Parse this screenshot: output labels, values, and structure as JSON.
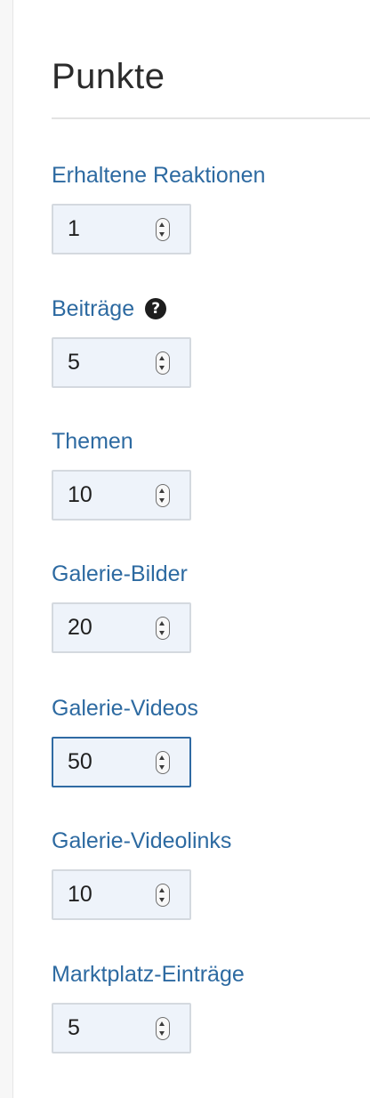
{
  "section": {
    "title": "Punkte"
  },
  "fields": [
    {
      "label": "Erhaltene Reaktionen",
      "value": "1",
      "has_help": false,
      "focused": false
    },
    {
      "label": "Beiträge",
      "value": "5",
      "has_help": true,
      "help_glyph": "?",
      "focused": false
    },
    {
      "label": "Themen",
      "value": "10",
      "has_help": false,
      "focused": false
    },
    {
      "label": "Galerie-Bilder",
      "value": "20",
      "has_help": false,
      "focused": false
    },
    {
      "label": "Galerie-Videos",
      "value": "50",
      "has_help": false,
      "focused": true
    },
    {
      "label": "Galerie-Videolinks",
      "value": "10",
      "has_help": false,
      "focused": false
    },
    {
      "label": "Marktplatz-Einträge",
      "value": "5",
      "has_help": false,
      "focused": false
    }
  ],
  "colors": {
    "label": "#2d6aa1",
    "input_background": "#eef3fa",
    "input_border": "#d4d9df",
    "input_focus_border": "#2f6aa3"
  },
  "icons": {
    "help": "question-circle-icon",
    "stepper": "number-stepper-icon"
  }
}
